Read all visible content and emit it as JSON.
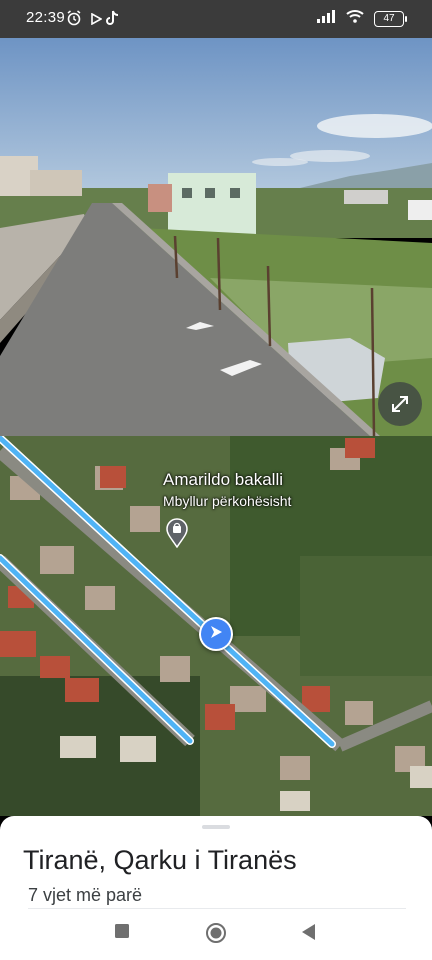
{
  "status_bar": {
    "time": "22:39",
    "icons_left": [
      "alarm-icon",
      "play-icon",
      "tiktok-icon"
    ],
    "icons_right": [
      "signal-icon",
      "wifi-icon"
    ],
    "battery": "47"
  },
  "map": {
    "place_name": "Amarildo bakalli",
    "place_status": "Mbyllur përkohësisht",
    "route_color": "#4fb3f5",
    "nav_color": "#4285f4"
  },
  "sheet": {
    "title": "Tiranë, Qarku i Tiranës",
    "subtitle": "7 vjet më parë"
  },
  "nav_bar": {
    "buttons": [
      "recents-button",
      "home-button",
      "back-button"
    ]
  }
}
